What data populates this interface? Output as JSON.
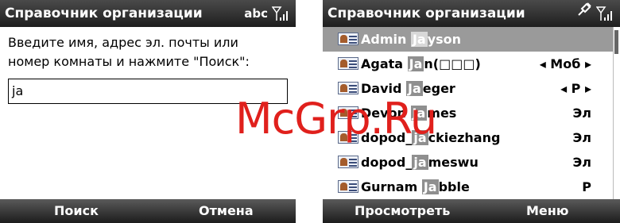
{
  "left_screen": {
    "title": "Справочник организации",
    "input_mode": "abc",
    "prompt": "Введите имя, адрес эл. почты или номер комнаты и нажмите \"Поиск\":",
    "query": "ja",
    "soft_left": "Поиск",
    "soft_right": "Отмена"
  },
  "right_screen": {
    "title": "Справочник организации",
    "soft_left": "Просмотреть",
    "soft_right": "Меню",
    "contacts": [
      {
        "pre": "Admin ",
        "match": "Ja",
        "post": "yson",
        "tag": "",
        "selected": true
      },
      {
        "pre": "Agata ",
        "match": "Ja",
        "post": "n(□□□)",
        "tag": "◂ Моб ▸"
      },
      {
        "pre": "David ",
        "match": "Ja",
        "post": "eger",
        "tag": "◂ P ▸"
      },
      {
        "pre": "Devon ",
        "match": "Ja",
        "post": "mes",
        "tag": "Эл"
      },
      {
        "pre": "dopod_",
        "match": "ja",
        "post": "ckiezhang",
        "tag": "Эл"
      },
      {
        "pre": "dopod_",
        "match": "ja",
        "post": "meswu",
        "tag": "Эл"
      },
      {
        "pre": "Gurnam ",
        "match": "Ja",
        "post": "bble",
        "tag": "P"
      }
    ]
  },
  "watermark": "McGrp.Ru"
}
